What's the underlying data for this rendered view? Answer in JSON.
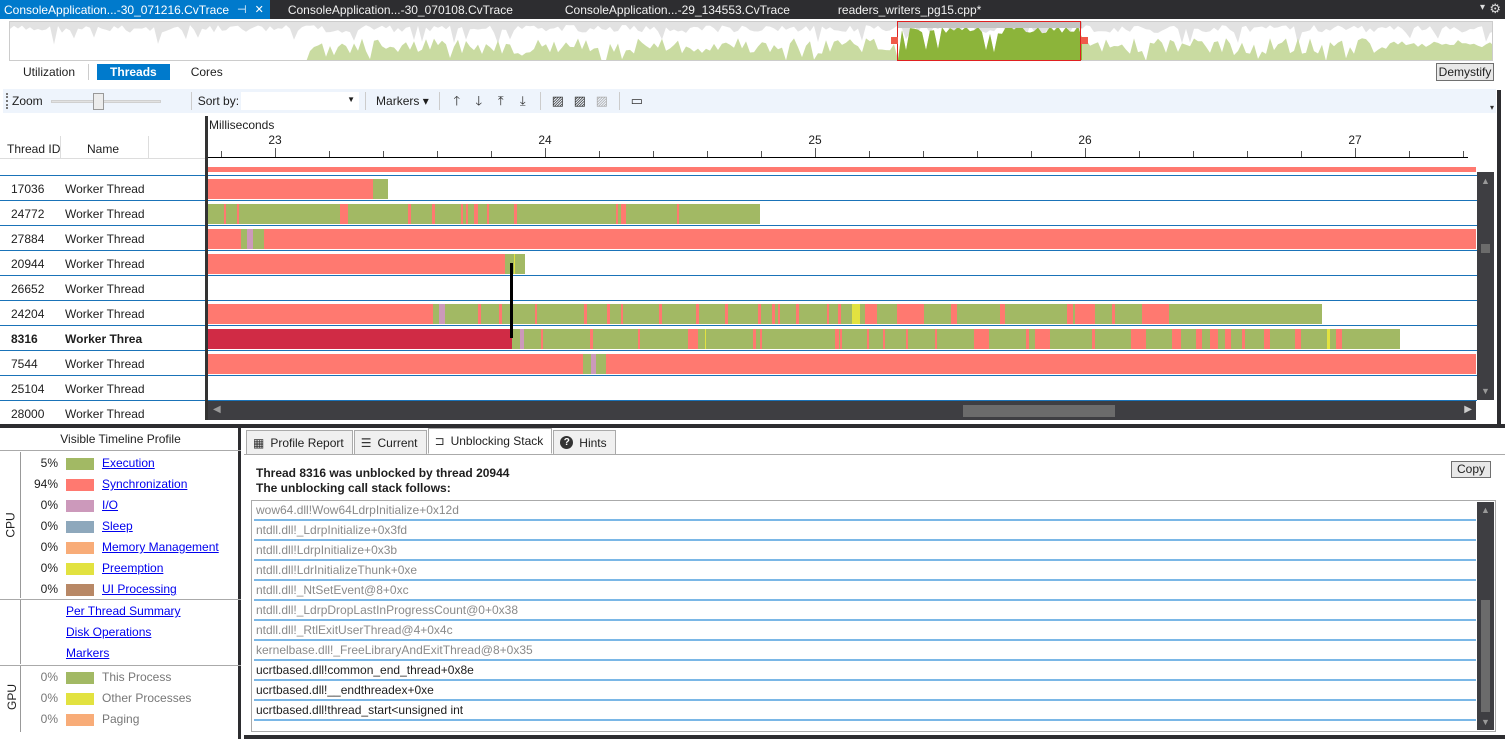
{
  "tabs": [
    {
      "label": "ConsoleApplication...-30_071216.CvTrace",
      "active": true,
      "pin_icon": "pin-icon",
      "close_icon": "close-icon"
    },
    {
      "label": "ConsoleApplication...-30_070108.CvTrace",
      "active": false
    },
    {
      "label": "ConsoleApplication...-29_134553.CvTrace",
      "active": false
    },
    {
      "label": "readers_writers_pg15.cpp*",
      "active": false
    }
  ],
  "tab_menu_icon": "▾",
  "settings_icon": "⚙",
  "views": {
    "items": [
      "Utilization",
      "Threads",
      "Cores"
    ],
    "active": "Threads"
  },
  "demystify_label": "Demystify",
  "toolbar": {
    "zoom_label": "Zoom",
    "zoom_level": 0.38,
    "sortby_label": "Sort by:",
    "sortby_value": "",
    "markers_label": "Markers ▾",
    "icons": [
      "move-up-icon",
      "move-down-icon",
      "move-top-icon",
      "move-bottom-icon",
      "add-marker-icon",
      "remove-marker-icon",
      "clear-markers-icon",
      "ruler-icon"
    ]
  },
  "thread_table": {
    "col_thread_id": "Thread ID",
    "col_name": "Name",
    "rows": [
      {
        "id": "17036",
        "name": "Worker Thread",
        "bold": false
      },
      {
        "id": "24772",
        "name": "Worker Thread",
        "bold": false
      },
      {
        "id": "27884",
        "name": "Worker Thread",
        "bold": false
      },
      {
        "id": "20944",
        "name": "Worker Thread",
        "bold": false
      },
      {
        "id": "26652",
        "name": "Worker Thread",
        "bold": false
      },
      {
        "id": "24204",
        "name": "Worker Thread",
        "bold": false
      },
      {
        "id": "8316",
        "name": "Worker Threa",
        "bold": true
      },
      {
        "id": "7544",
        "name": "Worker Thread",
        "bold": false
      },
      {
        "id": "25104",
        "name": "Worker Thread",
        "bold": false
      },
      {
        "id": "28000",
        "name": "Worker Thread",
        "bold": false
      }
    ]
  },
  "timeline": {
    "axis_label": "Milliseconds",
    "ticks": [
      "23",
      "24",
      "25",
      "26",
      "27"
    ],
    "range_ms": [
      22.75,
      27.45
    ],
    "colors": {
      "exec": "#a2b964",
      "sync": "#ff7970",
      "sync_selected": "#d02b45",
      "io": "#cc99bb",
      "preempt": "#e2e240"
    },
    "unblock_from_thread": "20944",
    "unblock_to_thread": "8316"
  },
  "legend": {
    "title": "Visible Timeline Profile",
    "cpu_label": "CPU",
    "gpu_label": "GPU",
    "cpu_items": [
      {
        "pct": "5%",
        "name": "Execution",
        "color": "#a2b964"
      },
      {
        "pct": "94%",
        "name": "Synchronization",
        "color": "#ff7970"
      },
      {
        "pct": "0%",
        "name": "I/O",
        "color": "#cc99bb"
      },
      {
        "pct": "0%",
        "name": "Sleep",
        "color": "#8ea8bc"
      },
      {
        "pct": "0%",
        "name": "Memory Management",
        "color": "#f8ac78"
      },
      {
        "pct": "0%",
        "name": "Preemption",
        "color": "#e2e240"
      },
      {
        "pct": "0%",
        "name": "UI Processing",
        "color": "#b88866"
      }
    ],
    "links": [
      "Per Thread Summary",
      "Disk Operations",
      "Markers"
    ],
    "gpu_items": [
      {
        "pct": "0%",
        "name": "This Process",
        "color": "#a2b964"
      },
      {
        "pct": "0%",
        "name": "Other Processes",
        "color": "#e2e240"
      },
      {
        "pct": "0%",
        "name": "Paging",
        "color": "#f8ac78"
      }
    ]
  },
  "details": {
    "tabs": [
      {
        "label": "Profile Report",
        "icon": "▦"
      },
      {
        "label": "Current",
        "icon": "☰"
      },
      {
        "label": "Unblocking Stack",
        "icon": "⊐"
      },
      {
        "label": "Hints",
        "icon": "?"
      }
    ],
    "active_tab": "Unblocking Stack",
    "heading": "Thread 8316 was unblocked by thread 20944",
    "subheading": "The unblocking call stack follows:",
    "copy_label": "Copy",
    "stack": [
      {
        "frame": "wow64.dll!Wow64LdrpInitialize+0x12d",
        "external": true
      },
      {
        "frame": "ntdll.dll!_LdrpInitialize+0x3fd",
        "external": true
      },
      {
        "frame": "ntdll.dll!LdrpInitialize+0x3b",
        "external": true
      },
      {
        "frame": "ntdll.dll!LdrInitializeThunk+0xe",
        "external": true
      },
      {
        "frame": "ntdll.dll!_NtSetEvent@8+0xc",
        "external": true
      },
      {
        "frame": "ntdll.dll!_LdrpDropLastInProgressCount@0+0x38",
        "external": true
      },
      {
        "frame": "ntdll.dll!_RtlExitUserThread@4+0x4c",
        "external": true
      },
      {
        "frame": "kernelbase.dll!_FreeLibraryAndExitThread@8+0x35",
        "external": true
      },
      {
        "frame": "ucrtbased.dll!common_end_thread+0x8e",
        "external": false
      },
      {
        "frame": "ucrtbased.dll!__endthreadex+0xe",
        "external": false
      },
      {
        "frame": "ucrtbased.dll!thread_start<unsigned int",
        "external": false
      }
    ]
  }
}
